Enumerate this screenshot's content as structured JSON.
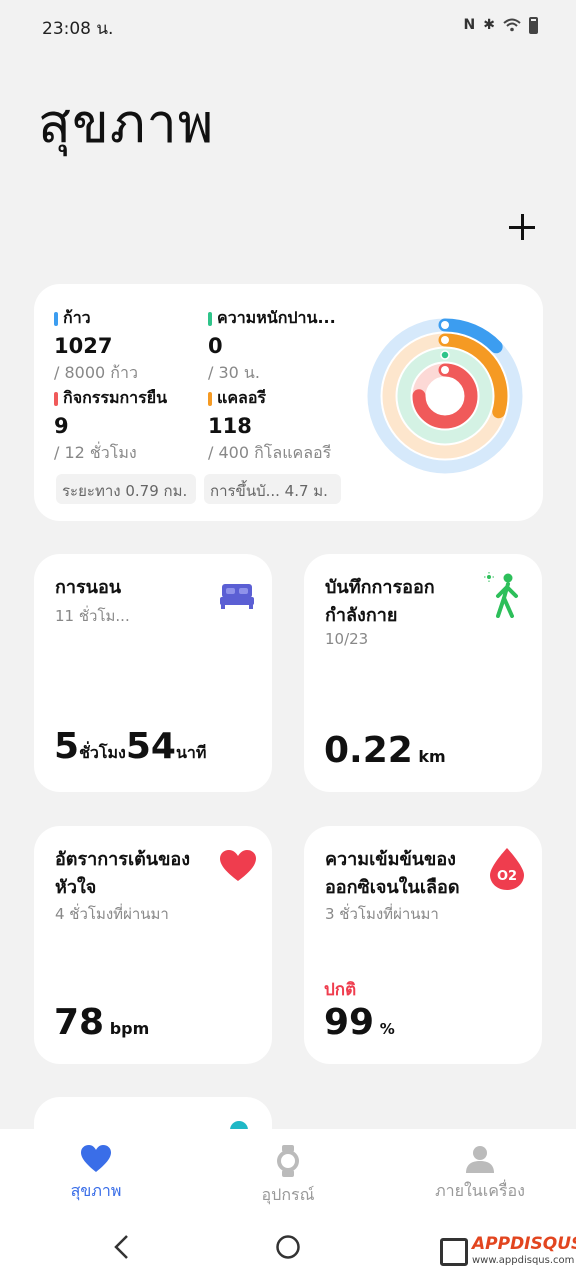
{
  "status": {
    "time": "23:08 น."
  },
  "page": {
    "title": "สุขภาพ"
  },
  "activity": {
    "steps": {
      "label": "ก้าว",
      "value": "1027",
      "goal": "/ 8000 ก้าว",
      "color": "#3c9df0"
    },
    "intensity": {
      "label": "ความหนักปาน...",
      "value": "0",
      "goal": "/ 30 น.",
      "color": "#2fc48a"
    },
    "standing": {
      "label": "กิจกรรมการยืน",
      "value": "9",
      "goal": "/ 12 ชั่วโมง",
      "color": "#f05a5a"
    },
    "calories": {
      "label": "แคลอรี",
      "value": "118",
      "goal": "/ 400 กิโลแคลอรี",
      "color": "#f59a23"
    },
    "distance_chip": "ระยะทาง  0.79 กม.",
    "floors_chip": "การขึ้นบั...    4.7 ม.",
    "ring_progress": {
      "steps": 0.128,
      "calories": 0.295,
      "intensity": 0.0,
      "standing": 0.75
    }
  },
  "sleep": {
    "title": "การนอน",
    "subtitle": "11 ชั่วโม...",
    "hours": "5",
    "hours_unit": "ชั่วโมง",
    "minutes": "54",
    "minutes_unit": "นาที"
  },
  "exercise": {
    "title_line1": "บันทึกการออก",
    "title_line2": "กำลังกาย",
    "date": "10/23",
    "value": "0.22",
    "unit": "km"
  },
  "heart": {
    "title_line1": "อัตราการเต้นของ",
    "title_line2": "หัวใจ",
    "subtitle": "4 ชั่วโมงที่ผ่านมา",
    "value": "78",
    "unit": "bpm"
  },
  "oxygen": {
    "title_line1": "ความเข้มข้นของ",
    "title_line2": "ออกซิเจนในเลือด",
    "subtitle": "3 ชั่วโมงที่ผ่านมา",
    "status": "ปกติ",
    "value": "99",
    "unit": "%",
    "icon_text": "O2"
  },
  "nav": {
    "health": "สุขภาพ",
    "devices": "อุปกรณ์",
    "profile": "ภายในเครื่อง"
  },
  "watermark": {
    "brand": "APPDISQUS",
    "url": "www.appdisqus.com"
  }
}
